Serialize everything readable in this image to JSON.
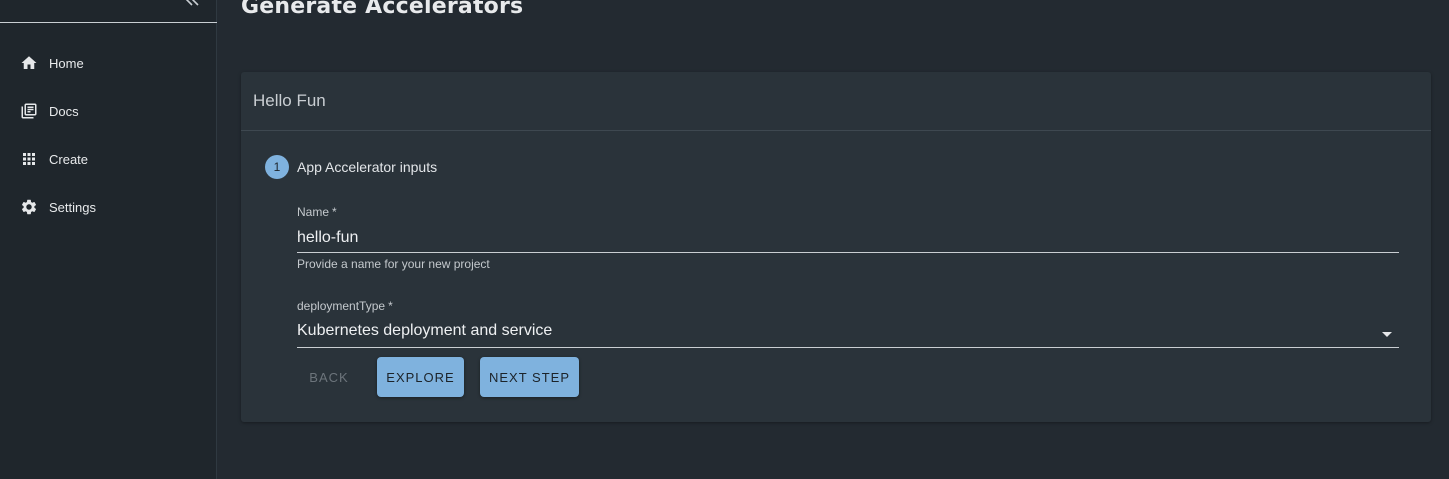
{
  "sidebar": {
    "items": [
      {
        "label": "Home",
        "icon": "home-icon"
      },
      {
        "label": "Docs",
        "icon": "docs-icon"
      },
      {
        "label": "Create",
        "icon": "grid-icon"
      },
      {
        "label": "Settings",
        "icon": "gear-icon"
      }
    ]
  },
  "page": {
    "title": "Generate Accelerators"
  },
  "card": {
    "title": "Hello Fun"
  },
  "stepper": {
    "step_number": "1",
    "step_label": "App Accelerator inputs"
  },
  "form": {
    "name": {
      "label": "Name",
      "required_mark": "*",
      "value": "hello-fun",
      "help": "Provide a name for your new project"
    },
    "deployment_type": {
      "label": "deploymentType",
      "required_mark": "*",
      "value": "Kubernetes deployment and service"
    }
  },
  "buttons": {
    "back": "BACK",
    "explore": "EXPLORE",
    "next": "NEXT STEP"
  },
  "colors": {
    "accent": "#7fb2de",
    "background": "#232a31",
    "card": "#2a333a",
    "sidebar": "#1f262c"
  }
}
